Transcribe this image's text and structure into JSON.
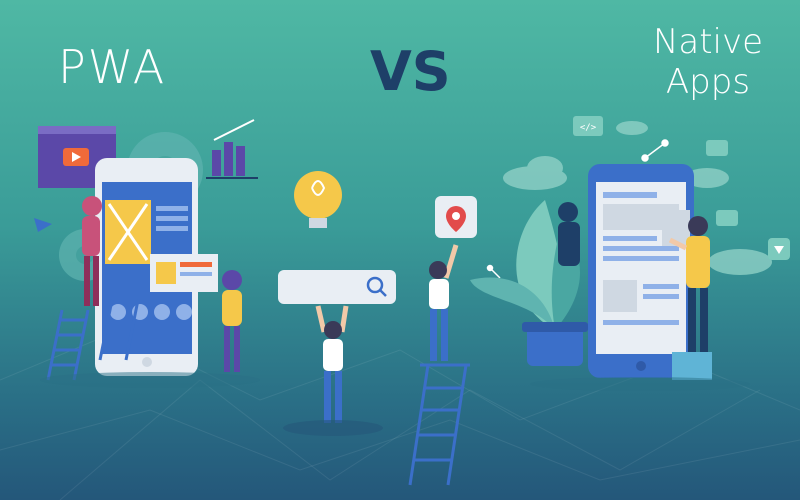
{
  "titles": {
    "left": "PWA",
    "center": "VS",
    "right_line1": "Native",
    "right_line2": "Apps"
  },
  "colors": {
    "background_top": "#4fb8a4",
    "background_bottom": "#24577a",
    "vs_text": "#1e3f68",
    "phone_frame": "#e9eef4",
    "native_phone": "#3b6fc9",
    "accent_yellow": "#f5c84a",
    "accent_purple": "#5b48a8",
    "pin_red": "#e24b4b"
  },
  "icons": [
    "video-play-icon",
    "bar-chart-icon",
    "gear-icon",
    "lightbulb-icon",
    "search-icon",
    "location-pin-icon",
    "code-icon",
    "cloud-icon",
    "diamond-icon"
  ]
}
